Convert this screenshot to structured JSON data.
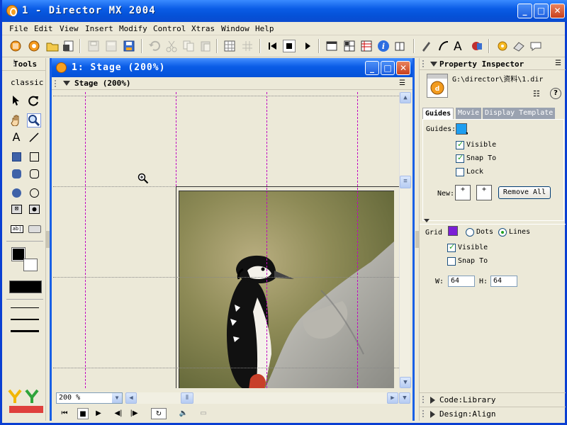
{
  "window": {
    "title": "1 - Director MX 2004"
  },
  "menu": [
    "File",
    "Edit",
    "View",
    "Insert",
    "Modify",
    "Control",
    "Xtras",
    "Window",
    "Help"
  ],
  "tools_panel": {
    "title": "Tools",
    "mode": "classic"
  },
  "stage_window": {
    "title": "1: Stage (200%)",
    "section": "Stage (200%)",
    "zoom": "200 %"
  },
  "property_inspector": {
    "title": "Property Inspector",
    "file_path": "G:\\director\\资料\\1.dir",
    "tabs": [
      "Guides",
      "Movie",
      "Display Template"
    ],
    "active_tab": "Guides",
    "guides": {
      "label": "Guides:",
      "color": "#1e9ef0",
      "visible_label": "Visible",
      "visible": true,
      "snap_label": "Snap To",
      "snap": true,
      "lock_label": "Lock",
      "lock": false,
      "new_label": "New:",
      "remove_all": "Remove All"
    },
    "grid": {
      "label": "Grid",
      "color": "#7b1ed6",
      "dots_label": "Dots",
      "lines_label": "Lines",
      "mode": "Lines",
      "visible_label": "Visible",
      "visible": true,
      "snap_label": "Snap To",
      "snap": false,
      "w_label": "W:",
      "w": "64",
      "h_label": "H:",
      "h": "64"
    },
    "collapsed_panels": [
      "Code:Library",
      "Design:Align"
    ]
  },
  "colors": {
    "title_blue": "#0a5ce6",
    "guide_magenta": "#c000c0",
    "face": "#ece9d8"
  }
}
